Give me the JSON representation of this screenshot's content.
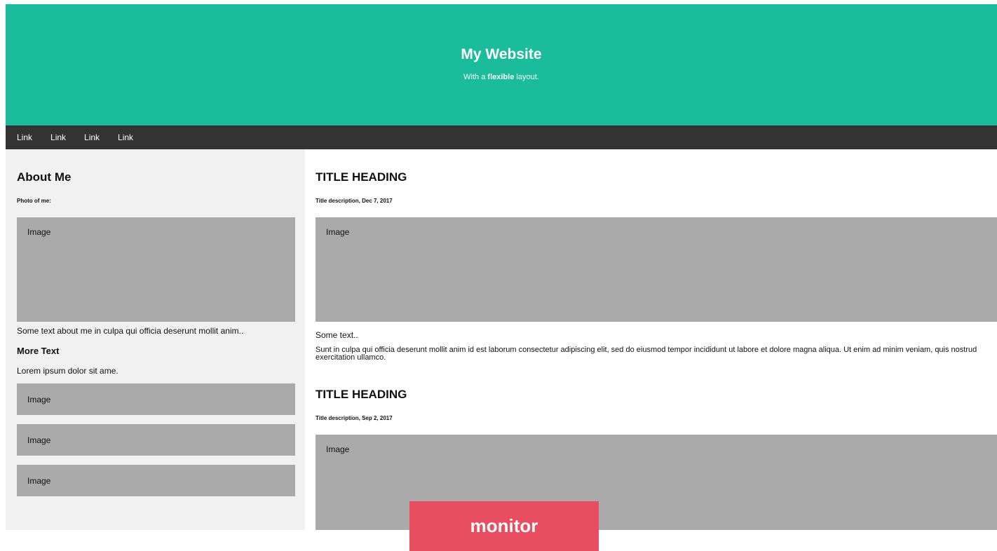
{
  "header": {
    "title": "My Website",
    "subtitle_pre": "With a",
    "subtitle_bold": "flexible",
    "subtitle_post": "layout."
  },
  "nav": {
    "links": [
      "Link",
      "Link",
      "Link",
      "Link"
    ]
  },
  "sidebar": {
    "heading": "About Me",
    "photo_label": "Photo of me:",
    "photo_placeholder": "Image",
    "about_text": "Some text about me in culpa qui officia deserunt mollit anim..",
    "more_heading": "More Text",
    "more_text": "Lorem ipsum dolor sit ame.",
    "images": [
      "Image",
      "Image",
      "Image"
    ]
  },
  "main": {
    "posts": [
      {
        "title": "TITLE HEADING",
        "description": "Title description, Dec 7, 2017",
        "image": "Image",
        "text": "Some text..",
        "body": "Sunt in culpa qui officia deserunt mollit anim id est laborum consectetur adipiscing elit, sed do eiusmod tempor incididunt ut labore et dolore magna aliqua. Ut enim ad minim veniam, quis nostrud exercitation ullamco."
      },
      {
        "title": "TITLE HEADING",
        "description": "Title description, Sep 2, 2017",
        "image": "Image"
      }
    ]
  },
  "badge": {
    "label": "monitor"
  },
  "colors": {
    "header_bg": "#1abc9c",
    "nav_bg": "#333333",
    "badge_bg": "#e84e5f",
    "image_bg": "#aaaaaa",
    "side_bg": "#f1f1f1"
  }
}
